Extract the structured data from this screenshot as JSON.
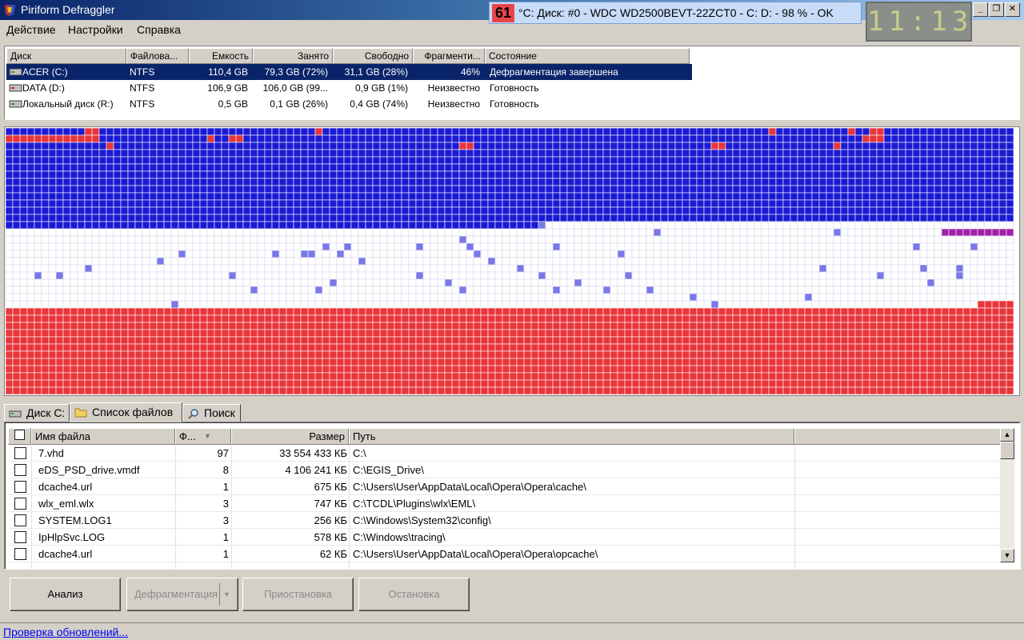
{
  "window": {
    "title": "Piriform Defraggler",
    "temperature": "61",
    "temperature_text": "°C: Диск: #0 - WDC WD2500BEVT-22ZCT0 - C: D: - 98 % - OK",
    "clock": "11:13",
    "minimize": "_",
    "restore": "❐",
    "close": "✕"
  },
  "menu": [
    "Действие",
    "Настройки",
    "Справка"
  ],
  "drives": {
    "columns": [
      "Диск",
      "Файлова...",
      "Емкость",
      "Занято",
      "Свободно",
      "Фрагменти...",
      "Состояние"
    ],
    "rows": [
      {
        "name": "ACER (C:)",
        "fs": "NTFS",
        "capacity": "110,4 GB",
        "used": "79,3 GB (72%)",
        "free": "31,1 GB (28%)",
        "frag": "46%",
        "status": "Дефрагментация завершена",
        "selected": true
      },
      {
        "name": "DATA (D:)",
        "fs": "NTFS",
        "capacity": "106,9 GB",
        "used": "106,0 GB (99...",
        "free": "0,9 GB (1%)",
        "frag": "Неизвестно",
        "status": "Готовность",
        "selected": false
      },
      {
        "name": "Локальный диск (R:)",
        "fs": "NTFS",
        "capacity": "0,5 GB",
        "used": "0,1 GB (26%)",
        "free": "0,4 GB (74%)",
        "frag": "Неизвестно",
        "status": "Готовность",
        "selected": false
      }
    ]
  },
  "colors": {
    "used_block": "#1a1ad4",
    "fragmented_block": "#e8353a",
    "free_block": "#ffffff",
    "light_used": "#7878e8",
    "mft_block": "#a020a8",
    "grid_line": "#d8d8ec"
  },
  "tabs": [
    {
      "label": "Диск C:",
      "icon": "drive-icon"
    },
    {
      "label": "Список файлов",
      "icon": "folder-icon"
    },
    {
      "label": "Поиск",
      "icon": "search-icon"
    }
  ],
  "files": {
    "columns": [
      "Имя файла",
      "Ф...",
      "Размер",
      "Путь"
    ],
    "rows": [
      {
        "name": "7.vhd",
        "frags": "97",
        "size": "33 554 433 КБ",
        "path": "C:\\"
      },
      {
        "name": "eDS_PSD_drive.vmdf",
        "frags": "8",
        "size": "4 106 241 КБ",
        "path": "C:\\EGIS_Drive\\"
      },
      {
        "name": "dcache4.url",
        "frags": "1",
        "size": "675 КБ",
        "path": "C:\\Users\\User\\AppData\\Local\\Opera\\Opera\\cache\\"
      },
      {
        "name": "wlx_eml.wlx",
        "frags": "3",
        "size": "747 КБ",
        "path": "C:\\TCDL\\Plugins\\wlx\\EML\\"
      },
      {
        "name": "SYSTEM.LOG1",
        "frags": "3",
        "size": "256 КБ",
        "path": "C:\\Windows\\System32\\config\\"
      },
      {
        "name": "IpHlpSvc.LOG",
        "frags": "1",
        "size": "578 КБ",
        "path": "C:\\Windows\\tracing\\"
      },
      {
        "name": "dcache4.url",
        "frags": "1",
        "size": "62 КБ",
        "path": "C:\\Users\\User\\AppData\\Local\\Opera\\Opera\\opcache\\"
      }
    ]
  },
  "buttons": {
    "analyze": "Анализ",
    "defrag": "Дефрагментация",
    "pause": "Приостановка",
    "stop": "Остановка"
  },
  "status": {
    "update_link": "Проверка обновлений..."
  }
}
